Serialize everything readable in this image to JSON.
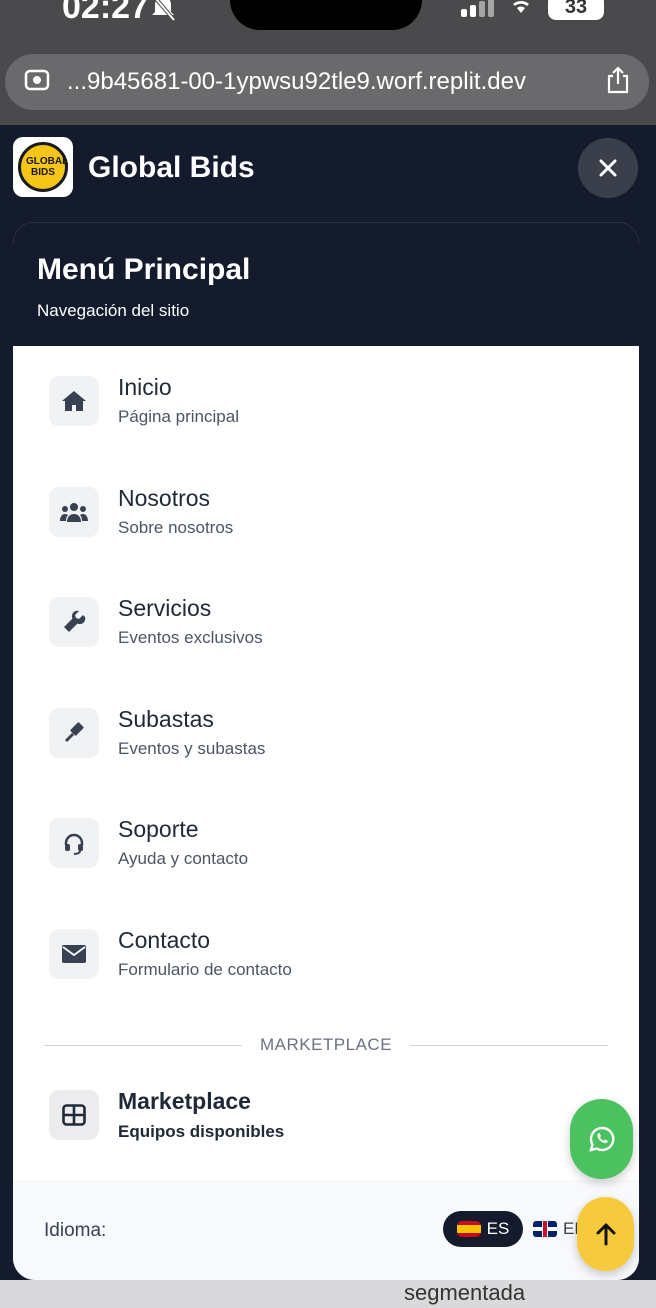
{
  "status_bar": {
    "time": "02:27",
    "battery": "33"
  },
  "browser": {
    "url": "...9b45681-00-1ypwsu92tle9.worf.replit.dev"
  },
  "header": {
    "brand": "Global Bids",
    "logo_text": "GLOBAL BIDS"
  },
  "drawer": {
    "title": "Menú Principal",
    "subtitle": "Navegación del sitio",
    "items": [
      {
        "label": "Inicio",
        "desc": "Página principal",
        "icon": "home-icon"
      },
      {
        "label": "Nosotros",
        "desc": "Sobre nosotros",
        "icon": "users-icon"
      },
      {
        "label": "Servicios",
        "desc": "Eventos exclusivos",
        "icon": "wrench-icon"
      },
      {
        "label": "Subastas",
        "desc": "Eventos y subastas",
        "icon": "gavel-icon"
      },
      {
        "label": "Soporte",
        "desc": "Ayuda y contacto",
        "icon": "headset-icon"
      },
      {
        "label": "Contacto",
        "desc": "Formulario de contacto",
        "icon": "envelope-icon"
      }
    ],
    "section_divider": "MARKETPLACE",
    "marketplace": {
      "label": "Marketplace",
      "desc": "Equipos disponibles",
      "icon": "grid-icon"
    },
    "language": {
      "label": "Idioma:",
      "active": "ES",
      "other": "EN"
    }
  },
  "background_peek": "segmentada",
  "colors": {
    "header_bg": "#141b2d",
    "whatsapp": "#4cc160",
    "scroll_top": "#f7ca3e"
  }
}
